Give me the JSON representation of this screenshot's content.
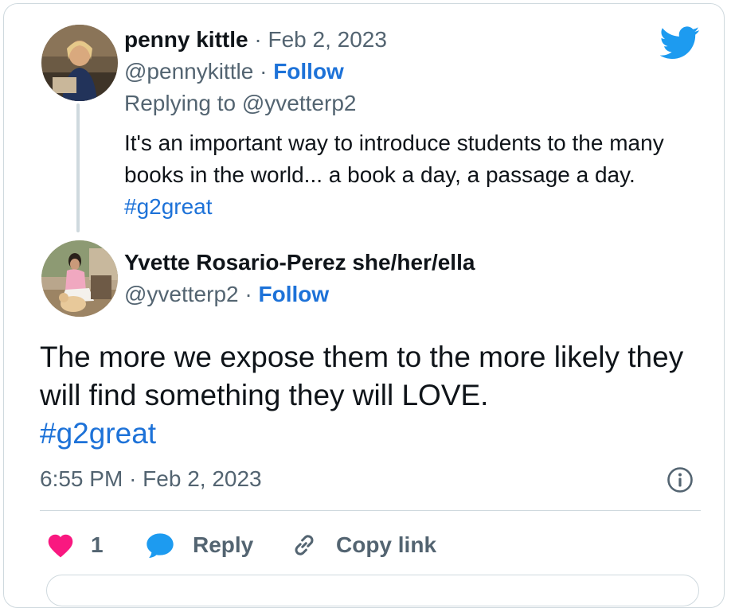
{
  "parent_tweet": {
    "author_name": "penny kittle",
    "date": "Feb 2, 2023",
    "handle": "@pennykittle",
    "follow_label": "Follow",
    "replying_to_prefix": "Replying to",
    "replying_to_handle": "@yvetterp2",
    "text": "It's an important way to introduce students to the many books in the world... a book a day, a passage a day.",
    "hashtag": "#g2great"
  },
  "main_tweet": {
    "author_name": "Yvette Rosario-Perez she/her/ella",
    "handle": "@yvetterp2",
    "follow_label": "Follow",
    "text": "The more we expose them to the more likely they will find something they will LOVE.",
    "hashtag": "#g2great",
    "time": "6:55 PM",
    "date": "Feb 2, 2023"
  },
  "separator": "·",
  "actions": {
    "like_count": "1",
    "reply_label": "Reply",
    "copy_link_label": "Copy link"
  },
  "icons": {
    "logo": "twitter-bird-icon",
    "info": "info-icon",
    "like": "heart-icon",
    "reply": "speech-bubble-icon",
    "copy_link": "link-icon"
  },
  "colors": {
    "brand_blue": "#1d9bf0",
    "link_blue": "#1d72d8",
    "like_pink": "#f91880",
    "muted_text": "#536471",
    "border": "#cfd9de"
  }
}
